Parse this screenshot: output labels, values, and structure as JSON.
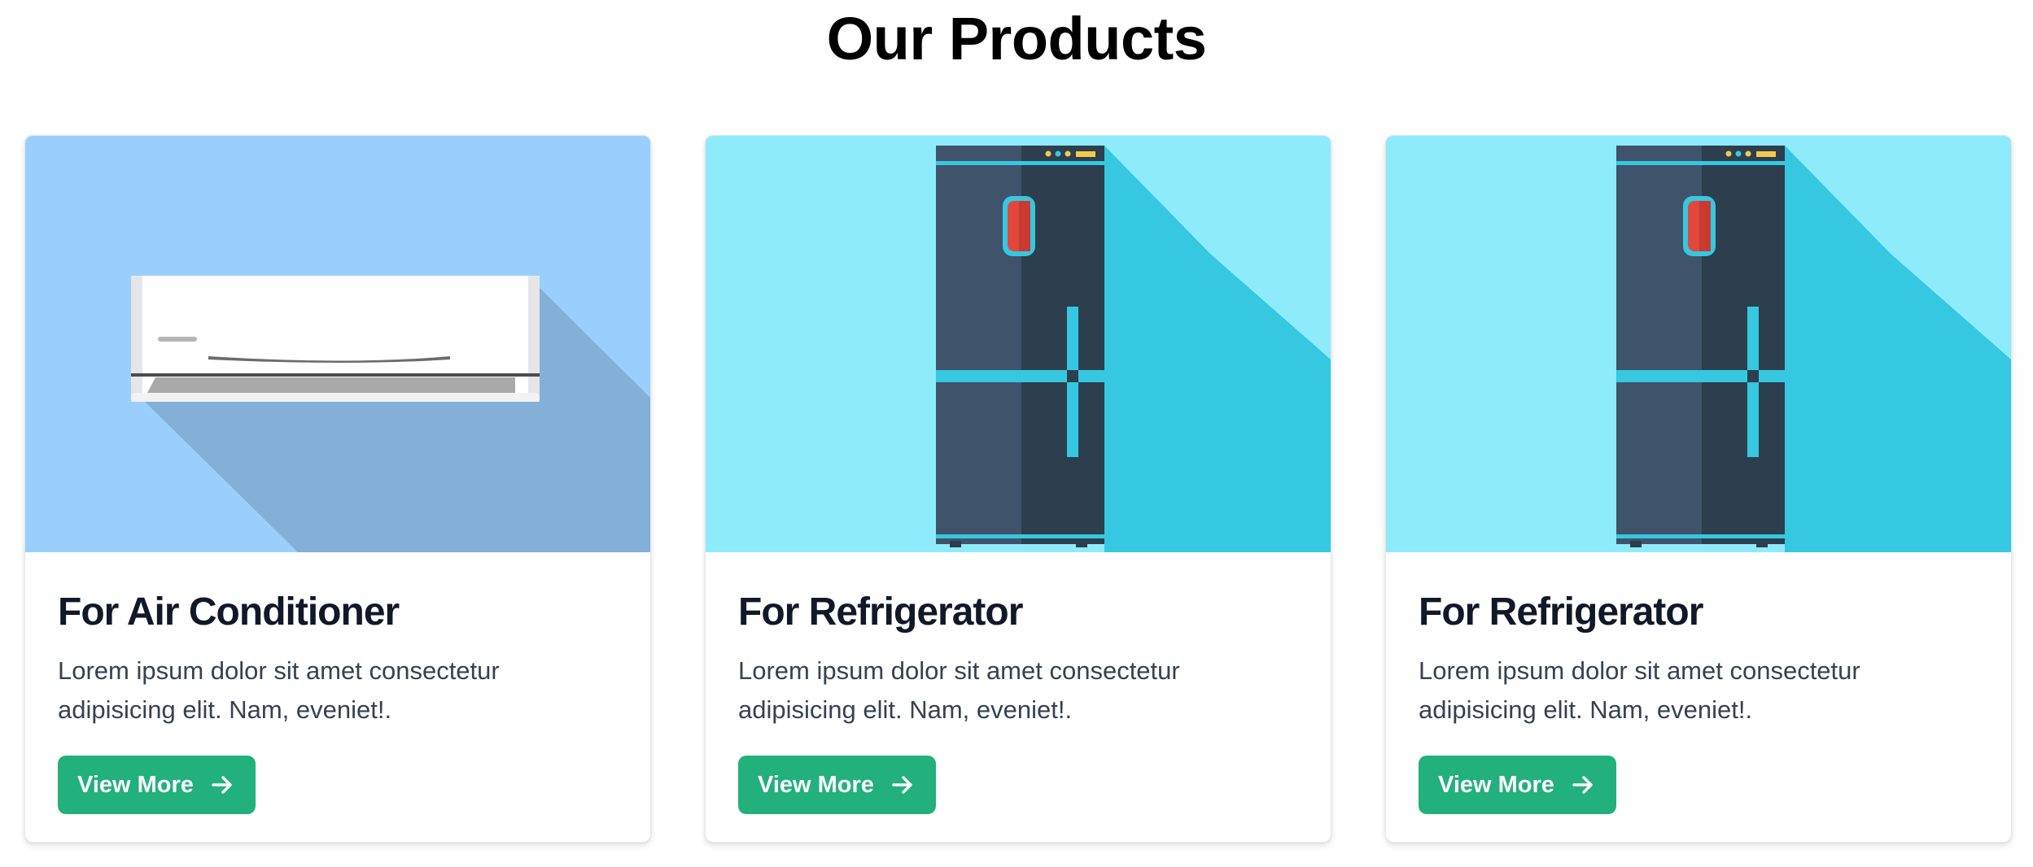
{
  "page": {
    "title": "Our Products"
  },
  "products": [
    {
      "title": "For Air Conditioner",
      "description": "Lorem ipsum dolor sit amet consectetur adipisicing elit. Nam, eveniet!.",
      "button_label": "View More",
      "image_icon": "air-conditioner-illustration",
      "image_bg": "#9bcffb"
    },
    {
      "title": "For Refrigerator",
      "description": "Lorem ipsum dolor sit amet consectetur adipisicing elit. Nam, eveniet!.",
      "button_label": "View More",
      "image_icon": "refrigerator-illustration",
      "image_bg": "#8eebfb"
    },
    {
      "title": "For Refrigerator",
      "description": "Lorem ipsum dolor sit amet consectetur adipisicing elit. Nam, eveniet!.",
      "button_label": "View More",
      "image_icon": "refrigerator-illustration",
      "image_bg": "#8eebfb"
    }
  ],
  "colors": {
    "button": "#22b07d",
    "title_text": "#111827",
    "body_text": "#374151"
  }
}
